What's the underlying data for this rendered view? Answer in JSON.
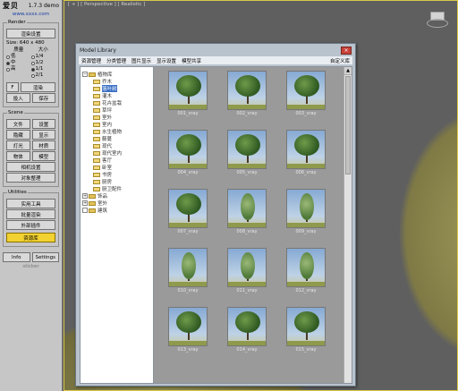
{
  "left_panel": {
    "logo": "爱贝",
    "version": "1.7.3 demo",
    "site": "www.xxxx.com",
    "render": {
      "label": "Render",
      "setup_button": "渲染设置",
      "size_text": "Size: 640 x 480",
      "col1_header": "质量",
      "col2_header": "大小",
      "radios": [
        {
          "label": "低",
          "selected": false
        },
        {
          "label": "1/4",
          "selected": false
        },
        {
          "label": "中",
          "selected": true
        },
        {
          "label": "1/2",
          "selected": false
        },
        {
          "label": "高",
          "selected": false
        },
        {
          "label": "1/1",
          "selected": true
        },
        {
          "label": "",
          "selected": false
        },
        {
          "label": "2/1",
          "selected": false
        }
      ],
      "button_f": "F",
      "button_render": "渲染",
      "button_in": "投入",
      "button_save": "保存"
    },
    "scene": {
      "label": "Scene",
      "buttons": [
        "文件",
        "设置",
        "隐藏",
        "显示",
        "灯光",
        "材质",
        "物体",
        "模型"
      ],
      "wide_buttons": [
        "相机设置",
        "对象整理"
      ]
    },
    "utilities": {
      "label": "Utilities",
      "buttons": [
        "实用工具",
        "批量渲染",
        "外部插件"
      ],
      "library_button": "资源库",
      "info_button": "Info",
      "settings_button": "Settings"
    },
    "footer": "sticker"
  },
  "viewport": {
    "label": "[ + ] [ Perspective ] [ Realistic ]",
    "cube_label": "TOP"
  },
  "library": {
    "title": "Model Library",
    "close_label": "×",
    "menu": [
      "资源管理",
      "分类管理",
      "图片显示",
      "显示设置",
      "模型共享"
    ],
    "menu_right": "自定义库",
    "tree": [
      {
        "label": "植物库",
        "level": 0,
        "expander": "−",
        "selected": false
      },
      {
        "label": "乔木",
        "level": 1,
        "selected": false
      },
      {
        "label": "落叶树",
        "level": 1,
        "selected": true
      },
      {
        "label": "灌木",
        "level": 1,
        "selected": false
      },
      {
        "label": "花卉盆栽",
        "level": 1,
        "selected": false
      },
      {
        "label": "草坪",
        "level": 1,
        "selected": false
      },
      {
        "label": "室外",
        "level": 1,
        "selected": false
      },
      {
        "label": "室内",
        "level": 1,
        "selected": false
      },
      {
        "label": "水生植物",
        "level": 1,
        "selected": false
      },
      {
        "label": "藤蔓",
        "level": 1,
        "selected": false
      },
      {
        "label": "现代",
        "level": 1,
        "selected": false
      },
      {
        "label": "现代室内",
        "level": 1,
        "selected": false
      },
      {
        "label": "客厅",
        "level": 1,
        "selected": false
      },
      {
        "label": "卧室",
        "level": 1,
        "selected": false
      },
      {
        "label": "书房",
        "level": 1,
        "selected": false
      },
      {
        "label": "厨房",
        "level": 1,
        "selected": false
      },
      {
        "label": "厨卫配件",
        "level": 1,
        "selected": false
      },
      {
        "label": "饰品",
        "level": 0,
        "expander": "+",
        "selected": false
      },
      {
        "label": "室外",
        "level": 0,
        "expander": "+",
        "selected": false
      },
      {
        "label": "建筑",
        "level": 0,
        "expander": "",
        "selected": false
      }
    ],
    "thumbnails": [
      {
        "caption": "001_vray",
        "sparse": false
      },
      {
        "caption": "002_vray",
        "sparse": false
      },
      {
        "caption": "003_vray",
        "sparse": false
      },
      {
        "caption": "004_vray",
        "sparse": false
      },
      {
        "caption": "005_vray",
        "sparse": false
      },
      {
        "caption": "006_vray",
        "sparse": false
      },
      {
        "caption": "007_vray",
        "sparse": false
      },
      {
        "caption": "008_vray",
        "sparse": true
      },
      {
        "caption": "009_vray",
        "sparse": true
      },
      {
        "caption": "010_vray",
        "sparse": true
      },
      {
        "caption": "011_vray",
        "sparse": true
      },
      {
        "caption": "012_vray",
        "sparse": true
      },
      {
        "caption": "013_vray",
        "sparse": false
      },
      {
        "caption": "014_vray",
        "sparse": false
      },
      {
        "caption": "015_vray",
        "sparse": false
      }
    ]
  }
}
